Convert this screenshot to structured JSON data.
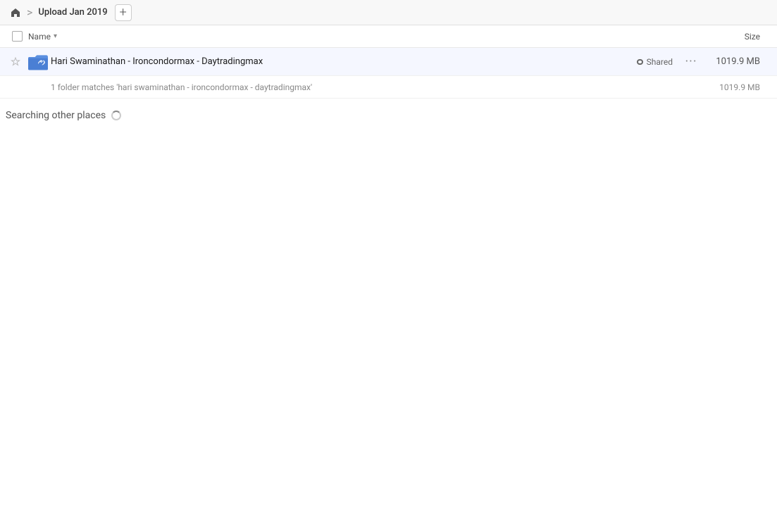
{
  "topbar": {
    "home_icon": "home",
    "separator": ">",
    "breadcrumb_title": "Upload Jan 2019",
    "add_tab_label": "+"
  },
  "columns": {
    "name_label": "Name",
    "size_label": "Size"
  },
  "file_row": {
    "name": "Hari Swaminathan - Ironcondormax - Daytradingmax",
    "shared_label": "Shared",
    "size": "1019.9 MB",
    "more_icon": "···"
  },
  "match_info": {
    "text": "1 folder matches 'hari swaminathan - ironcondormax - daytradingmax'",
    "size": "1019.9 MB"
  },
  "searching": {
    "text": "Searching other places"
  }
}
